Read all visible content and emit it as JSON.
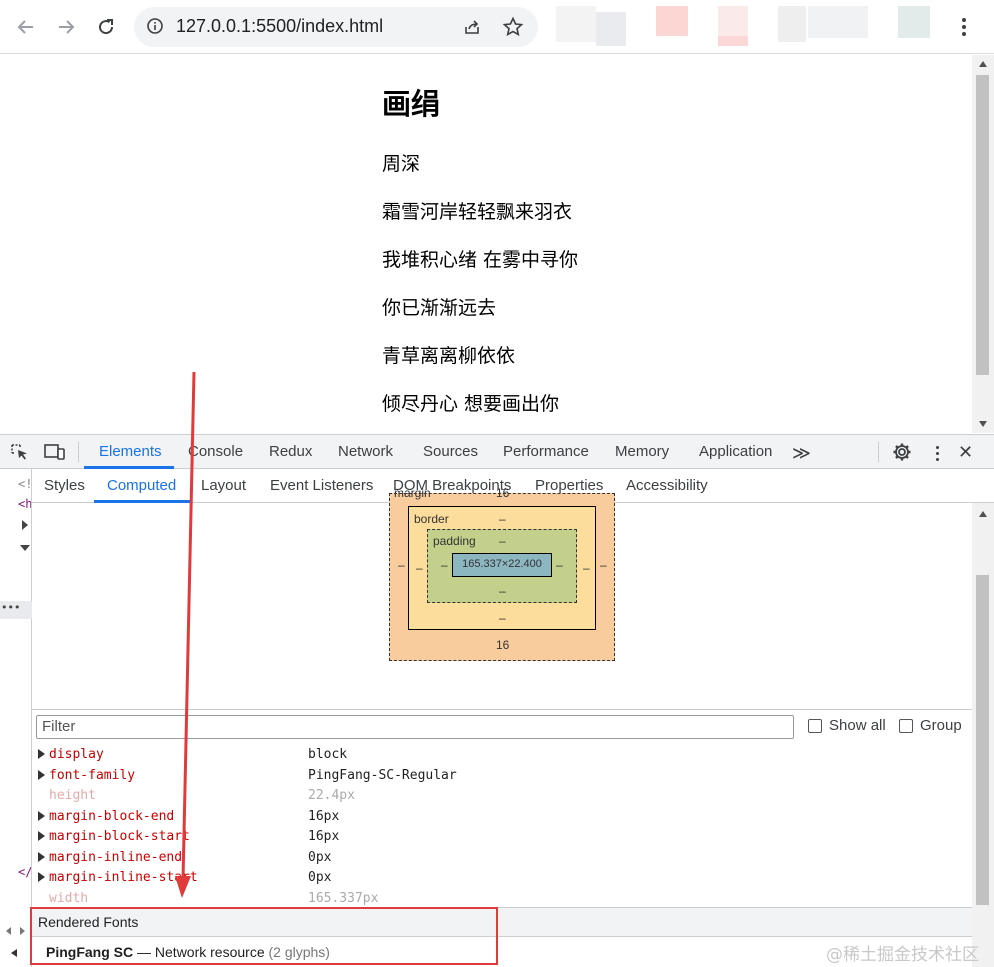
{
  "browser": {
    "url": "127.0.0.1:5500/index.html"
  },
  "page": {
    "title": "画绢",
    "lines": [
      "周深",
      "霜雪河岸轻轻飘来羽衣",
      "我堆积心绪 在雾中寻你",
      "你已渐渐远去",
      "青草离离柳依依",
      "倾尽丹心 想要画出你"
    ]
  },
  "devtools": {
    "tabs": [
      "Elements",
      "Console",
      "Redux",
      "Network",
      "Sources",
      "Performance",
      "Memory",
      "Application"
    ],
    "active_tab": "Elements",
    "more_tabs_glyph": "≫",
    "subtabs": [
      "Styles",
      "Computed",
      "Layout",
      "Event Listeners",
      "DOM Breakpoints",
      "Properties",
      "Accessibility"
    ],
    "active_subtab": "Computed",
    "dom_gutter": {
      "line1": "<!",
      "line2": "<h",
      "closing": "</"
    },
    "box_model": {
      "margin_label": "margin",
      "margin_top": "16",
      "margin_bottom": "16",
      "margin_left": "–",
      "margin_right": "–",
      "border_label": "border",
      "border_top": "–",
      "border_bottom": "–",
      "border_left": "–",
      "border_right": "–",
      "padding_label": "padding",
      "padding_top": "–",
      "padding_bottom": "–",
      "padding_left": "–",
      "padding_right": "–",
      "content": "165.337×22.400"
    },
    "filter_placeholder": "Filter",
    "show_all_label": "Show all",
    "group_label": "Group",
    "properties": [
      {
        "name": "display",
        "value": "block",
        "inherited": false
      },
      {
        "name": "font-family",
        "value": "PingFang-SC-Regular",
        "inherited": false
      },
      {
        "name": "height",
        "value": "22.4px",
        "inherited": true
      },
      {
        "name": "margin-block-end",
        "value": "16px",
        "inherited": false
      },
      {
        "name": "margin-block-start",
        "value": "16px",
        "inherited": false
      },
      {
        "name": "margin-inline-end",
        "value": "0px",
        "inherited": false
      },
      {
        "name": "margin-inline-start",
        "value": "0px",
        "inherited": false
      },
      {
        "name": "width",
        "value": "165.337px",
        "inherited": true
      }
    ],
    "rendered_fonts": {
      "title": "Rendered Fonts",
      "font_name": "PingFang SC",
      "dash": "—",
      "source": "Network resource",
      "glyphs": "(2 glyphs)"
    }
  },
  "annotation": {
    "arrow_color": "#e03a3a",
    "box_color": "#e03a3a"
  },
  "watermark": "@稀土掘金技术社区",
  "colors": {
    "accent": "#1a73e8",
    "prop_name": "#c80000",
    "margin_fill": "#f9cc9d",
    "border_fill": "#fddd9b",
    "padding_fill": "#c3d08b",
    "content_fill": "#8cb6c0"
  }
}
